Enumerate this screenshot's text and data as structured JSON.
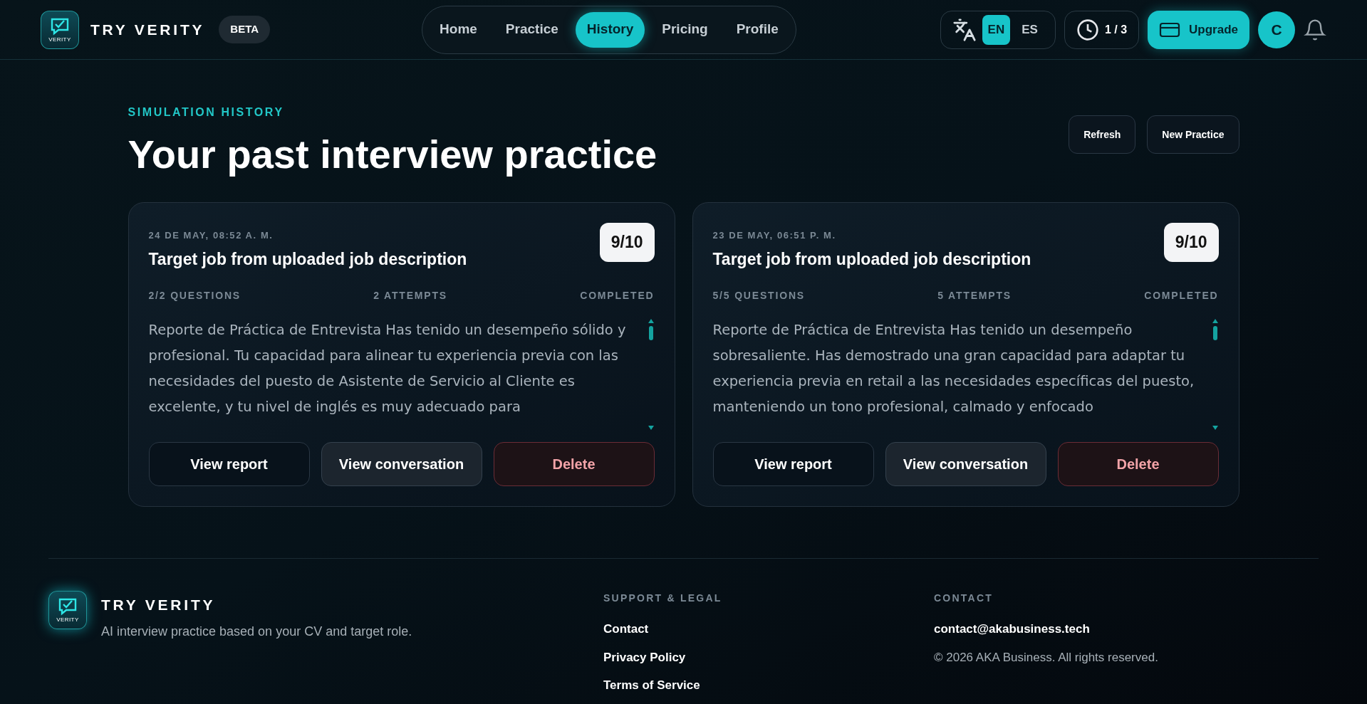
{
  "header": {
    "brand": "TRY VERITY",
    "logo_text": "VERITY",
    "badge": "BETA",
    "nav": [
      {
        "label": "Home",
        "selected": false
      },
      {
        "label": "Practice",
        "selected": false
      },
      {
        "label": "History",
        "selected": true
      },
      {
        "label": "Pricing",
        "selected": false
      },
      {
        "label": "Profile",
        "selected": false
      }
    ],
    "languages": [
      {
        "label": "EN",
        "selected": true
      },
      {
        "label": "ES",
        "selected": false
      }
    ],
    "credits": "1 / 3",
    "upgrade": "Upgrade",
    "avatar": "C"
  },
  "page": {
    "eyebrow": "SIMULATION HISTORY",
    "title": "Your past interview practice",
    "actions": [
      "Refresh",
      "New Practice"
    ]
  },
  "sessions": [
    {
      "date": "24 DE MAY, 08:52 A. M.",
      "title": "Target job from uploaded job description",
      "score": "9/10",
      "questions": "2/2 QUESTIONS",
      "attempts": "2 ATTEMPTS",
      "status": "COMPLETED",
      "summary": "Reporte de Práctica de Entrevista Has tenido un desempeño sólido y profesional. Tu capacidad para alinear tu experiencia previa con las necesidades del puesto de Asistente de Servicio al Cliente es excelente, y tu nivel de inglés es muy adecuado para",
      "buttons": [
        {
          "label": "View report",
          "kind": "plain"
        },
        {
          "label": "View conversation",
          "kind": "muted"
        },
        {
          "label": "Delete",
          "kind": "danger"
        }
      ]
    },
    {
      "date": "23 DE MAY, 06:51 P. M.",
      "title": "Target job from uploaded job description",
      "score": "9/10",
      "questions": "5/5 QUESTIONS",
      "attempts": "5 ATTEMPTS",
      "status": "COMPLETED",
      "summary": "Reporte de Práctica de Entrevista Has tenido un desempeño sobresaliente. Has demostrado una gran capacidad para adaptar tu experiencia previa en retail a las necesidades específicas del puesto, manteniendo un tono profesional, calmado y enfocado",
      "buttons": [
        {
          "label": "View report",
          "kind": "plain"
        },
        {
          "label": "View conversation",
          "kind": "muted"
        },
        {
          "label": "Delete",
          "kind": "danger"
        }
      ]
    }
  ],
  "footer": {
    "brand": "TRY VERITY",
    "logo_text": "VERITY",
    "tagline": "AI interview practice based on your CV and target role.",
    "support_heading": "SUPPORT & LEGAL",
    "links": [
      "Contact",
      "Privacy Policy",
      "Terms of Service"
    ],
    "contact_heading": "CONTACT",
    "email": "contact@akabusiness.tech",
    "copyright": "© 2026 AKA Business. All rights reserved."
  }
}
